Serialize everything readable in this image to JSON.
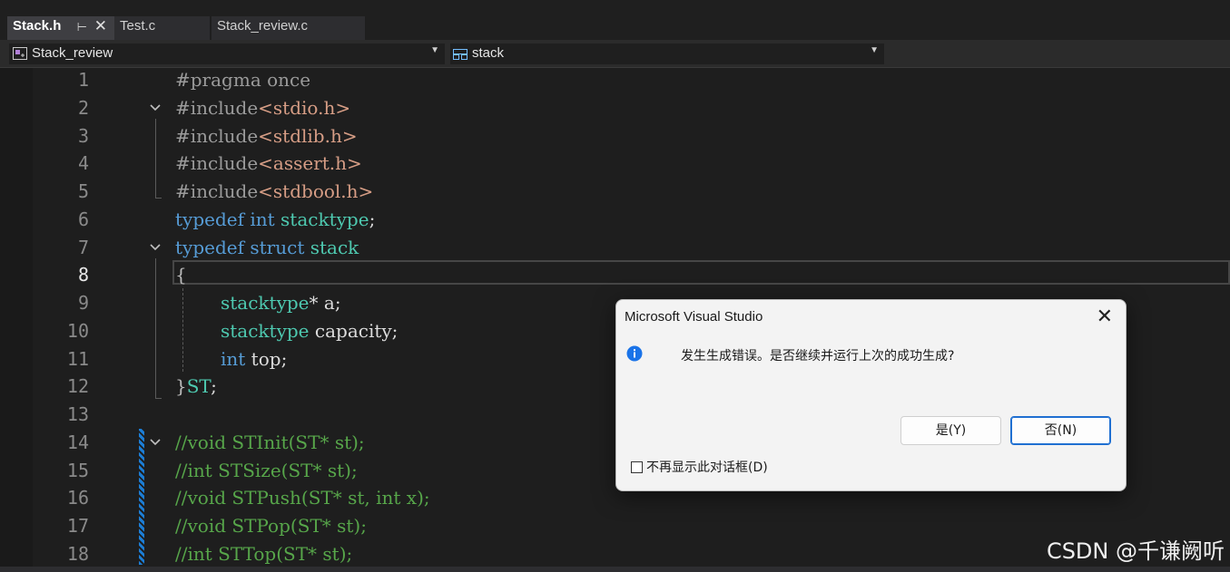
{
  "tabs": [
    {
      "label": "Stack.h",
      "active": true
    },
    {
      "label": "Test.c",
      "active": false
    },
    {
      "label": "Stack_review.c",
      "active": false
    }
  ],
  "tab_pin_glyph": "⊢",
  "tab_close_glyph": "✕",
  "navbar": {
    "project": "Stack_review",
    "scope": "stack"
  },
  "editor": {
    "current_line": 8,
    "lines": [
      {
        "n": "1"
      },
      {
        "n": "2"
      },
      {
        "n": "3"
      },
      {
        "n": "4"
      },
      {
        "n": "5"
      },
      {
        "n": "6"
      },
      {
        "n": "7"
      },
      {
        "n": "8"
      },
      {
        "n": "9"
      },
      {
        "n": "10"
      },
      {
        "n": "11"
      },
      {
        "n": "12"
      },
      {
        "n": "13"
      },
      {
        "n": "14"
      },
      {
        "n": "15"
      },
      {
        "n": "16"
      },
      {
        "n": "17"
      },
      {
        "n": "18"
      }
    ],
    "code": {
      "l1": {
        "a": "#pragma once"
      },
      "l2": {
        "a": "#include",
        "b": "<stdio.h>"
      },
      "l3": {
        "a": "#include",
        "b": "<stdlib.h>"
      },
      "l4": {
        "a": "#include",
        "b": "<assert.h>"
      },
      "l5": {
        "a": "#include",
        "b": "<stdbool.h>"
      },
      "l6": {
        "a": "typedef",
        "b": " int",
        "c": " stacktype",
        "d": ";"
      },
      "l7": {
        "a": "typedef",
        "b": " struct",
        "c": " stack"
      },
      "l8": {
        "a": "{"
      },
      "l9": {
        "a": "stacktype",
        "b": "* a;"
      },
      "l10": {
        "a": "stacktype",
        "b": " capacity;"
      },
      "l11": {
        "a": "int",
        "b": " top;"
      },
      "l12": {
        "a": "}",
        "b": "ST",
        "c": ";"
      },
      "l14": {
        "a": "//void STInit(ST* st);"
      },
      "l15": {
        "a": "//int STSize(ST* st);"
      },
      "l16": {
        "a": "//void STPush(ST* st, int x);"
      },
      "l17": {
        "a": "//void STPop(ST* st);"
      },
      "l18": {
        "a": "//int STTop(ST* st);"
      }
    }
  },
  "dialog": {
    "title": "Microsoft Visual Studio",
    "message": "发生生成错误。是否继续并运行上次的成功生成?",
    "yes_label": "是(Y)",
    "no_label": "否(N)",
    "checkbox_label": "不再显示此对话框(D)",
    "close_glyph": "✕"
  },
  "watermark": "CSDN @千谦阙听",
  "colors": {
    "keyword": "#569cd6",
    "type": "#4ec9b0",
    "string": "#d69d85",
    "comment": "#57a64a",
    "dialog_bg": "#f3f3f3",
    "primary_border": "#1f6fd1"
  }
}
